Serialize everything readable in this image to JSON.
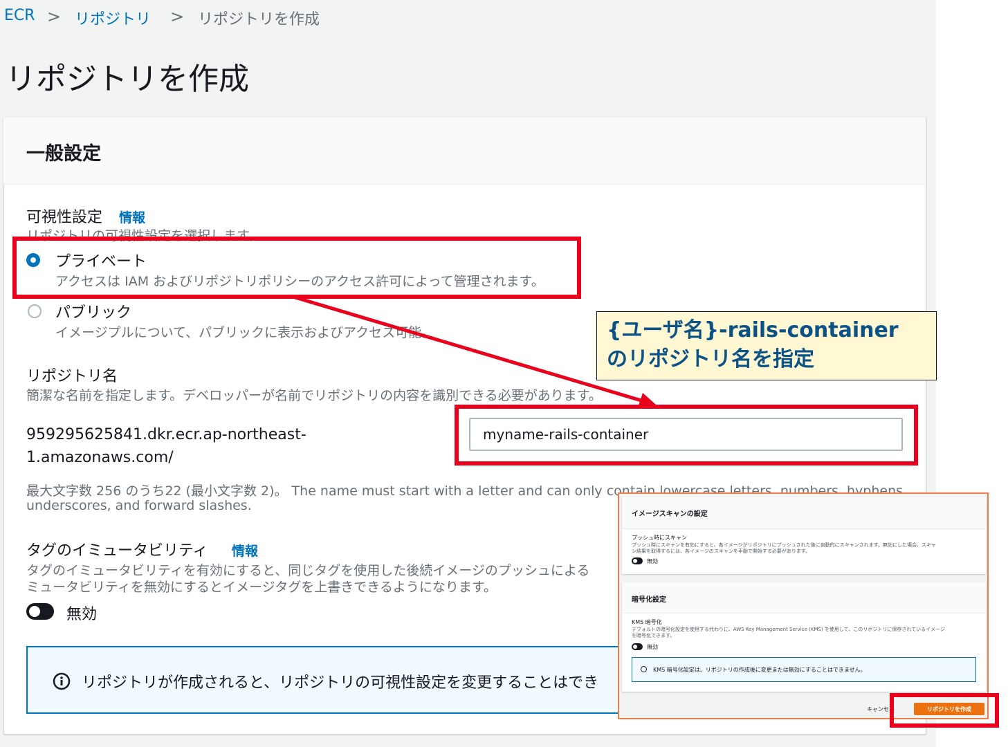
{
  "breadcrumb": {
    "items": [
      "ECR",
      "リポジトリ",
      "リポジトリを作成"
    ],
    "separator": ">"
  },
  "page_title": "リポジトリを作成",
  "general": {
    "title": "一般設定",
    "visibility": {
      "label": "可視性設定",
      "info": "情報",
      "desc": "リポジトリの可視性設定を選択します。",
      "private": {
        "label": "プライベート",
        "desc": "アクセスは IAM およびリポジトリポリシーのアクセス許可によって管理されます。",
        "selected": true
      },
      "public": {
        "label": "パブリック",
        "desc": "イメージプルについて、パブリックに表示およびアクセス可能。",
        "selected": false
      }
    },
    "repo_name": {
      "label": "リポジトリ名",
      "desc": "簡潔な名前を指定します。デベロッパーが名前でリポジトリの内容を識別できる必要があります。",
      "prefix_line1": "959295625841.dkr.ecr.ap-northeast-",
      "prefix_line2": "1.amazonaws.com/",
      "value": "myname-rails-container",
      "hint_line1": "最大文字数 256 のうち22 (最小文字数 2)。 The name must start with a letter and can only contain lowercase letters, numbers, hyphens,",
      "hint_line2": "underscores, and forward slashes."
    },
    "immutability": {
      "label": "タグのイミュータビリティ",
      "info": "情報",
      "desc_line1": "タグのイミュータビリティを有効にすると、同じタグを使用した後続イメージのプッシュによる",
      "desc_line2": "ミュータビリティを無効にするとイメージタグを上書きできるようになります。",
      "toggle_label": "無効",
      "enabled": false
    },
    "alert": "リポジトリが作成されると、リポジトリの可視性設定を変更することはでき"
  },
  "callout": {
    "line1": "{ユーザ名}-rails-container",
    "line2": "のリポジトリ名を指定"
  },
  "inset": {
    "scan": {
      "title": "イメージスキャンの設定",
      "label": "プッシュ時にスキャン",
      "desc_line1": "プッシュ時にスキャンを有効にすると、各イメージがリポジトリにプッシュされた後に自動的にスキャンされます。無効にした場合、スキャ",
      "desc_line2": "ン結果を取得するには、各イメージのスキャンを手動で開始する必要があります。",
      "toggle_label": "無効"
    },
    "encryption": {
      "title": "暗号化設定",
      "label": "KMS 暗号化",
      "desc_line1": "デフォルトの暗号化設定を使用する代わりに、AWS Key Management Service (KMS) を使用して、このリポジトリに保存されているイメージ",
      "desc_line2": "を暗号化できます。",
      "toggle_label": "無効",
      "alert": "KMS 暗号化設定は、リポジトリの作成後に変更または無効にすることはできません。"
    },
    "cancel": "キャンセル",
    "create": "リポジトリを作成"
  },
  "colors": {
    "accent": "#0073bb",
    "highlight": "#e8001c",
    "primary_button": "#ec7211",
    "callout_bg": "#fff8d2"
  }
}
